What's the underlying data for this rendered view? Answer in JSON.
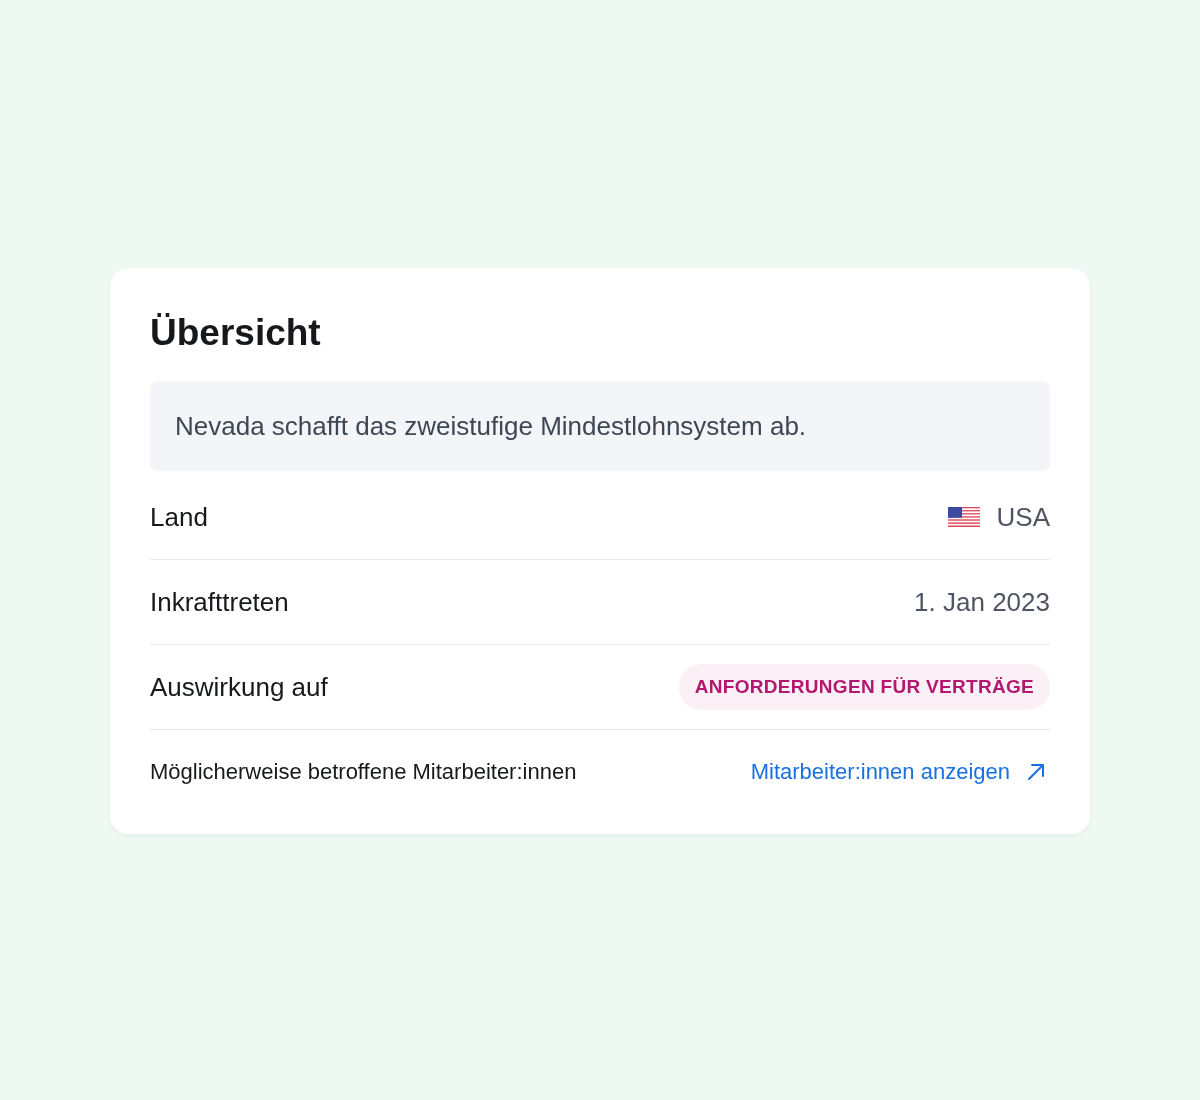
{
  "card": {
    "title": "Übersicht",
    "summary": "Nevada schafft das zweistufige Mindestlohnsystem ab.",
    "rows": [
      {
        "kind": "country",
        "label": "Land",
        "value": "USA"
      },
      {
        "kind": "text",
        "label": "Inkrafttreten",
        "value": "1. Jan 2023"
      },
      {
        "kind": "badge",
        "label": "Auswirkung auf",
        "value": "ANFORDERUNGEN FÜR VERTRÄGE"
      },
      {
        "kind": "link",
        "label": "Möglicherweise betroffene Mitarbeiter:innen",
        "value": "Mitarbeiter:innen anzeigen"
      }
    ]
  }
}
